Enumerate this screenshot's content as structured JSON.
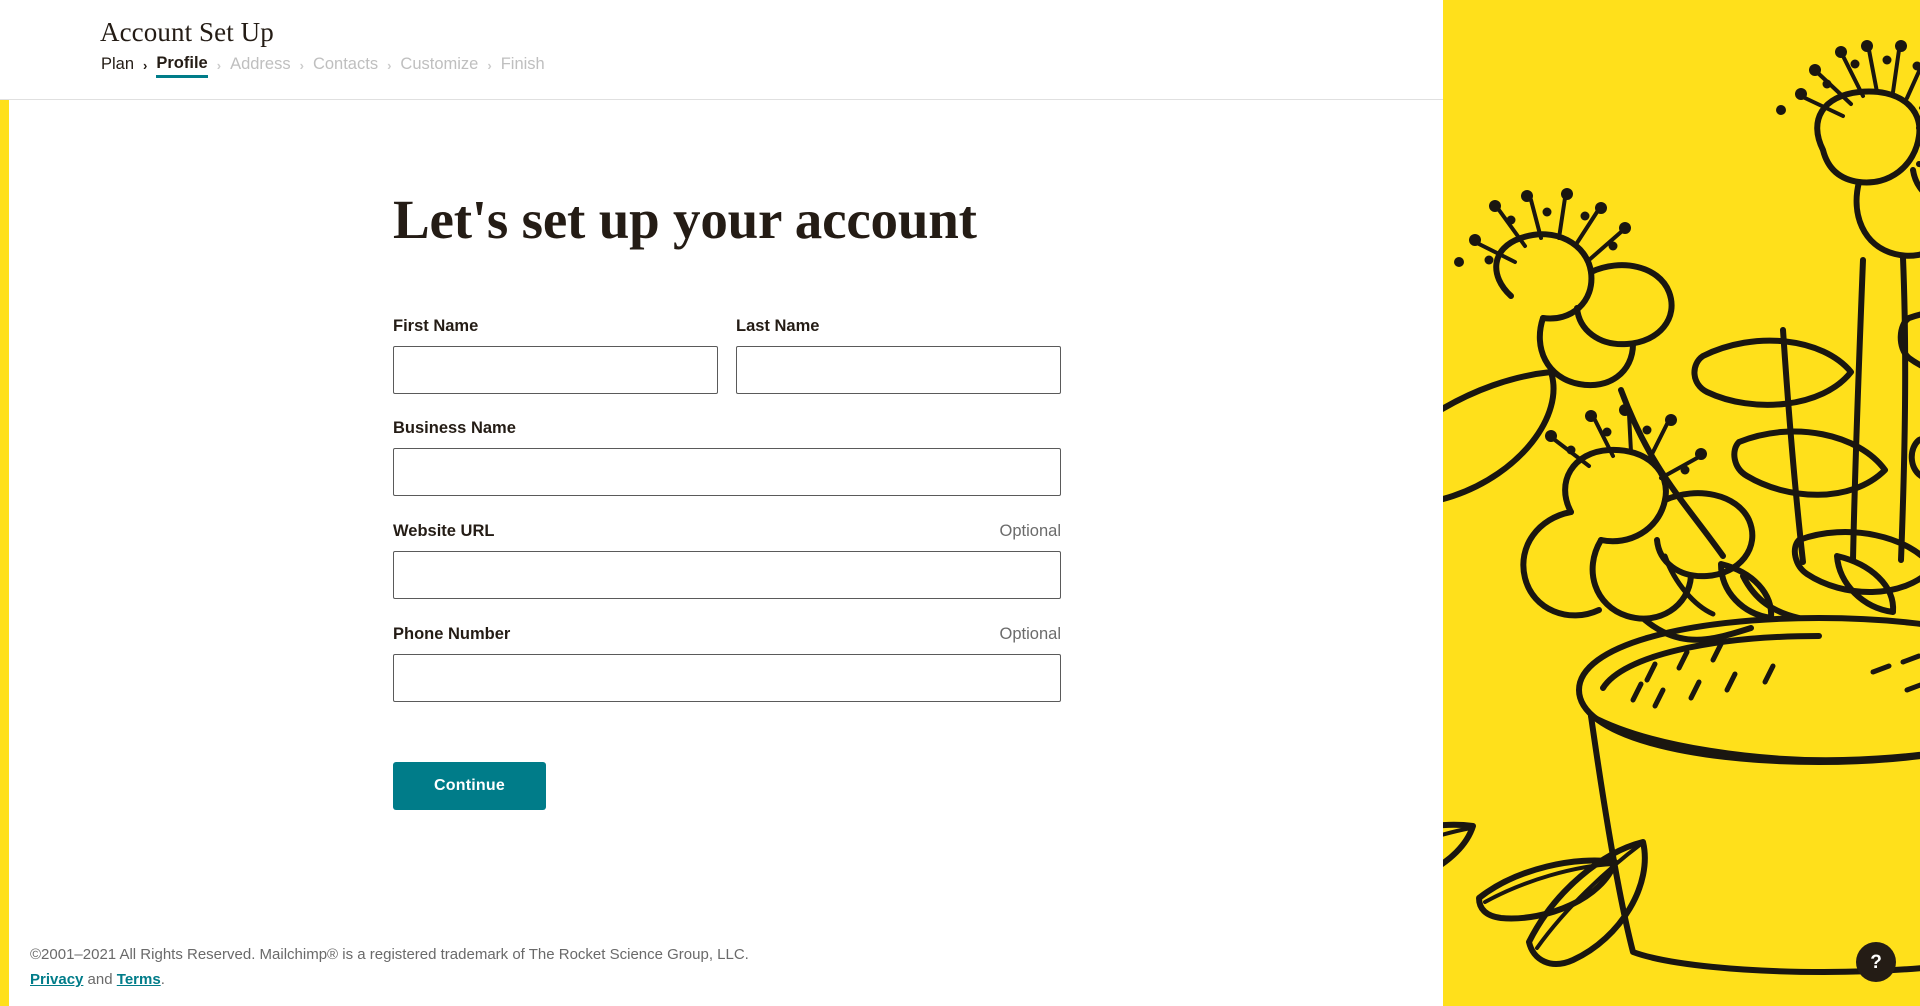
{
  "header": {
    "title": "Account Set Up",
    "breadcrumb": [
      {
        "label": "Plan",
        "state": "done"
      },
      {
        "label": "Profile",
        "state": "active"
      },
      {
        "label": "Address",
        "state": "upcoming"
      },
      {
        "label": "Contacts",
        "state": "upcoming"
      },
      {
        "label": "Customize",
        "state": "upcoming"
      },
      {
        "label": "Finish",
        "state": "upcoming"
      }
    ],
    "separator": "›"
  },
  "main": {
    "page_title": "Let's set up your account",
    "fields": {
      "first_name": {
        "label": "First Name",
        "value": "",
        "placeholder": ""
      },
      "last_name": {
        "label": "Last Name",
        "value": "",
        "placeholder": ""
      },
      "business_name": {
        "label": "Business Name",
        "value": "",
        "placeholder": ""
      },
      "website_url": {
        "label": "Website URL",
        "value": "",
        "placeholder": "",
        "optional": "Optional"
      },
      "phone_number": {
        "label": "Phone Number",
        "value": "",
        "placeholder": "",
        "optional": "Optional"
      }
    },
    "continue_label": "Continue"
  },
  "footer": {
    "copyright": "©2001–2021 All Rights Reserved. Mailchimp® is a registered trademark of The Rocket Science Group, LLC.",
    "privacy_label": "Privacy",
    "and_label": " and ",
    "terms_label": "Terms",
    "period": "."
  },
  "help": {
    "label": "?"
  },
  "colors": {
    "brand_yellow": "#ffe01b",
    "teal": "#007c89",
    "ink": "#241c15",
    "muted": "#6a6a6a",
    "upcoming": "#bfbfbf"
  }
}
